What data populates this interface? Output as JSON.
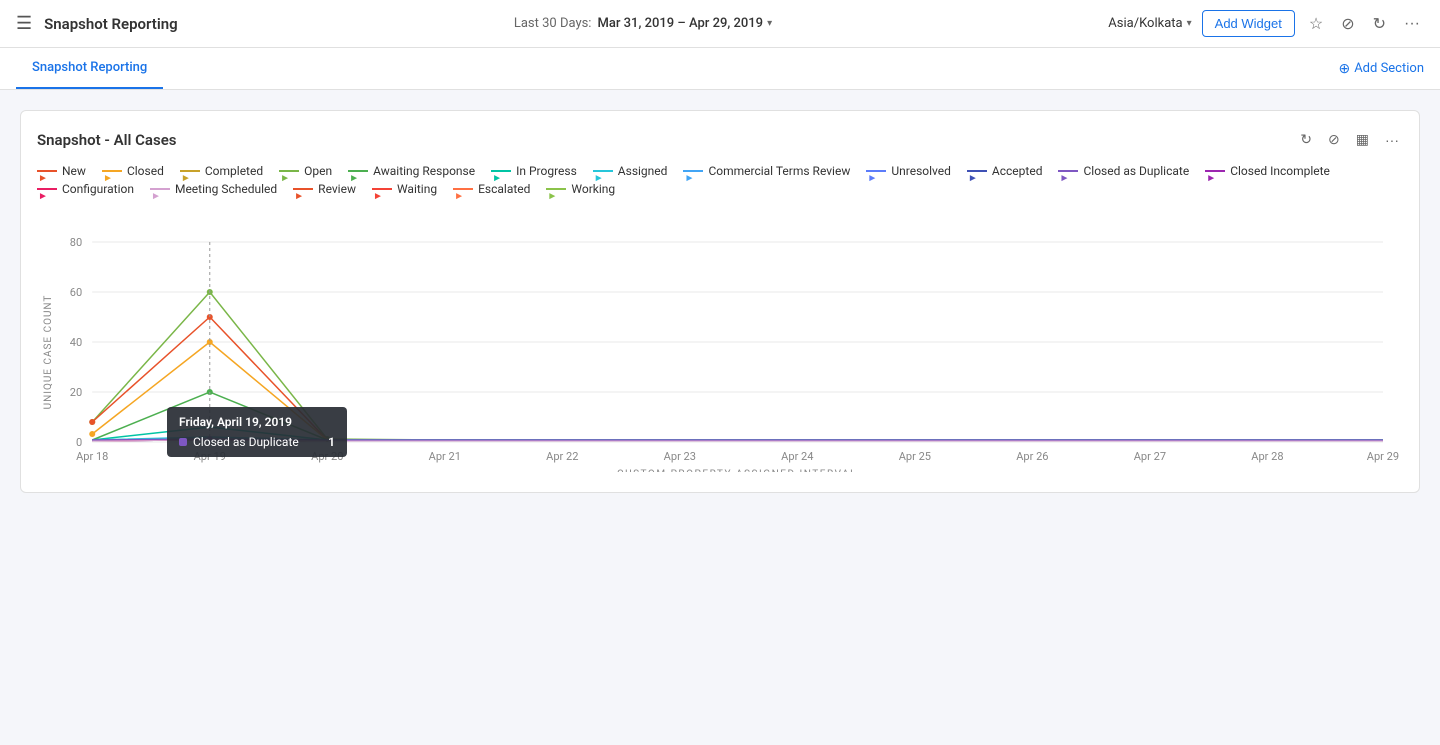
{
  "nav": {
    "hamburger": "☰",
    "title": "Snapshot Reporting",
    "date_label": "Last 30 Days:",
    "date_range": "Mar 31, 2019 – Apr 29, 2019",
    "timezone": "Asia/Kolkata",
    "add_widget_label": "Add Widget",
    "add_section_label": "Add Section"
  },
  "tabs": [
    {
      "label": "Snapshot Reporting",
      "active": true
    }
  ],
  "card": {
    "title": "Snapshot - All Cases",
    "x_axis_label": "CUSTOM PROPERTY ASSIGNED INTERVAL",
    "y_axis_label": "UNIQUE CASE COUNT"
  },
  "legend": [
    {
      "label": "New",
      "color": "#e8522a"
    },
    {
      "label": "Closed",
      "color": "#f5a623"
    },
    {
      "label": "Completed",
      "color": "#c8a22a"
    },
    {
      "label": "Open",
      "color": "#7ab648"
    },
    {
      "label": "Awaiting Response",
      "color": "#4caf50"
    },
    {
      "label": "In Progress",
      "color": "#00c4a4"
    },
    {
      "label": "Assigned",
      "color": "#26c6da"
    },
    {
      "label": "Commercial Terms Review",
      "color": "#42a5f5"
    },
    {
      "label": "Unresolved",
      "color": "#5c7cfa"
    },
    {
      "label": "Accepted",
      "color": "#3f51b5"
    },
    {
      "label": "Closed as Duplicate",
      "color": "#7e57c2"
    },
    {
      "label": "Closed Incomplete",
      "color": "#9c27b0"
    },
    {
      "label": "Configuration",
      "color": "#e91e63"
    },
    {
      "label": "Meeting Scheduled",
      "color": "#d4a1d0"
    },
    {
      "label": "Review",
      "color": "#e8522a"
    },
    {
      "label": "Waiting",
      "color": "#f44336"
    },
    {
      "label": "Escalated",
      "color": "#ff7043"
    },
    {
      "label": "Working",
      "color": "#8bc34a"
    }
  ],
  "tooltip": {
    "date": "Friday, April 19, 2019",
    "row_label": "Closed as Duplicate",
    "row_value": "1",
    "row_color": "#7e57c2"
  },
  "x_labels": [
    "Apr 18",
    "Apr 19",
    "Apr 20",
    "Apr 21",
    "Apr 22",
    "Apr 23",
    "Apr 24",
    "Apr 25",
    "Apr 26",
    "Apr 27",
    "Apr 28",
    "Apr 29"
  ],
  "y_labels": [
    "0",
    "20",
    "40",
    "60",
    "80"
  ]
}
